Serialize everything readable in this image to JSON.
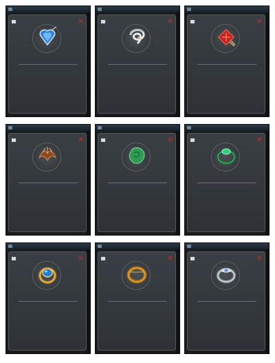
{
  "colors": {
    "card_bg": "#191b1d",
    "panel_bg": "#3a3f44",
    "close_red": "#d22a28",
    "name_green": "#5fd35f",
    "name_purple": "#c85ee6",
    "name_white": "#e6e6e6",
    "stat_blue": "#6aa6ff"
  },
  "cards": [
    {
      "id": "card-1",
      "title": "",
      "tag": "",
      "icon_name": "shield-pendant-icon",
      "item_name": "",
      "item_type": "",
      "desc": [
        "",
        ""
      ],
      "stats": [
        {
          "key": "",
          "val": ""
        },
        {
          "key": "",
          "val": ""
        },
        {
          "key": "",
          "val": ""
        }
      ]
    },
    {
      "id": "card-2",
      "title": "",
      "tag": "",
      "icon_name": "knot-amulet-icon",
      "item_name": "",
      "item_type": "",
      "desc": [
        "",
        ""
      ],
      "stats": [
        {
          "key": "",
          "val": ""
        },
        {
          "key": "",
          "val": ""
        }
      ]
    },
    {
      "id": "card-3",
      "title": "",
      "tag": "",
      "icon_name": "red-knot-charm-icon",
      "item_name": "",
      "item_type": "",
      "desc": [
        "",
        ""
      ],
      "stats": [
        {
          "key": "",
          "val": ""
        },
        {
          "key": "",
          "val": ""
        }
      ]
    },
    {
      "id": "card-4",
      "title": "",
      "tag": "",
      "icon_name": "bronze-wing-emblem-icon",
      "item_name": "",
      "item_type": "",
      "desc": [
        "",
        ""
      ],
      "stats": [
        {
          "key": "",
          "val": ""
        }
      ]
    },
    {
      "id": "card-5",
      "title": "",
      "tag": "",
      "icon_name": "jade-charm-icon",
      "item_name": "",
      "item_type": "",
      "desc": [
        "",
        ""
      ],
      "stats": [
        {
          "key": "",
          "val": ""
        }
      ]
    },
    {
      "id": "card-6",
      "title": "",
      "tag": "",
      "icon_name": "green-gem-ring-icon",
      "item_name": "",
      "item_type": "",
      "desc": [
        "",
        ""
      ],
      "stats": [
        {
          "key": "",
          "val": ""
        },
        {
          "key": "",
          "val": ""
        },
        {
          "key": "",
          "val": ""
        },
        {
          "key": "",
          "val": ""
        },
        {
          "key": "",
          "val": ""
        },
        {
          "key": "",
          "val": ""
        }
      ]
    },
    {
      "id": "card-7",
      "title": "",
      "tag": "",
      "icon_name": "gold-blue-gem-ring-icon",
      "item_name": "",
      "item_type": "",
      "desc": [
        "",
        ""
      ],
      "stats": [
        {
          "key": "",
          "val": ""
        },
        {
          "key": "",
          "val": ""
        },
        {
          "key": "",
          "val": ""
        },
        {
          "key": "",
          "val": ""
        },
        {
          "key": "",
          "val": ""
        },
        {
          "key": "",
          "val": ""
        }
      ]
    },
    {
      "id": "card-8",
      "title": "",
      "tag": "",
      "icon_name": "gold-band-ring-icon",
      "item_name": "",
      "item_type": "",
      "desc": [
        "",
        ""
      ],
      "stats": [
        {
          "key": "",
          "val": ""
        },
        {
          "key": "",
          "val": ""
        },
        {
          "key": "",
          "val": ""
        },
        {
          "key": "",
          "val": ""
        }
      ]
    },
    {
      "id": "card-9",
      "title": "",
      "tag": "",
      "icon_name": "silver-ornate-ring-icon",
      "item_name": "",
      "item_type": "",
      "desc": [
        "",
        ""
      ],
      "stats": [
        {
          "key": "",
          "val": ""
        },
        {
          "key": "",
          "val": ""
        },
        {
          "key": "",
          "val": ""
        },
        {
          "key": "",
          "val": ""
        },
        {
          "key": "",
          "val": ""
        },
        {
          "key": "",
          "val": ""
        }
      ]
    }
  ]
}
